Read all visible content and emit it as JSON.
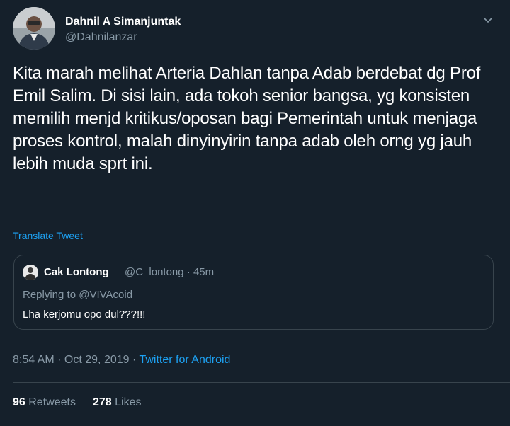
{
  "author": {
    "name": "Dahnil A Simanjuntak",
    "handle": "@Dahnilanzar",
    "avatar_icon": "profile-photo"
  },
  "tweet": {
    "text": "Kita marah melihat Arteria Dahlan tanpa Adab berdebat dg Prof Emil Salim. Di sisi lain, ada tokoh senior bangsa, yg konsisten memilih menjd kritikus/oposan bagi Pemerintah untuk menjaga proses kontrol, malah dinyinyirin tanpa adab oleh orng yg jauh lebih muda sprt ini.",
    "translate_label": "Translate Tweet"
  },
  "quoted": {
    "name": "Cak Lontong",
    "handle": "@C_lontong",
    "time": "45m",
    "replying_prefix": "Replying to ",
    "replying_to": "@VIVAcoid",
    "text": "Lha kerjomu opo dul???!!!"
  },
  "meta": {
    "time": "8:54 AM",
    "date": "Oct 29, 2019",
    "separator": " · ",
    "source": "Twitter for Android"
  },
  "stats": {
    "retweets_count": "96",
    "retweets_label": "Retweets",
    "likes_count": "278",
    "likes_label": "Likes"
  },
  "colors": {
    "background": "#15202b",
    "text": "#ffffff",
    "muted": "#8899a6",
    "link": "#1da1f2",
    "border": "#38444d"
  }
}
